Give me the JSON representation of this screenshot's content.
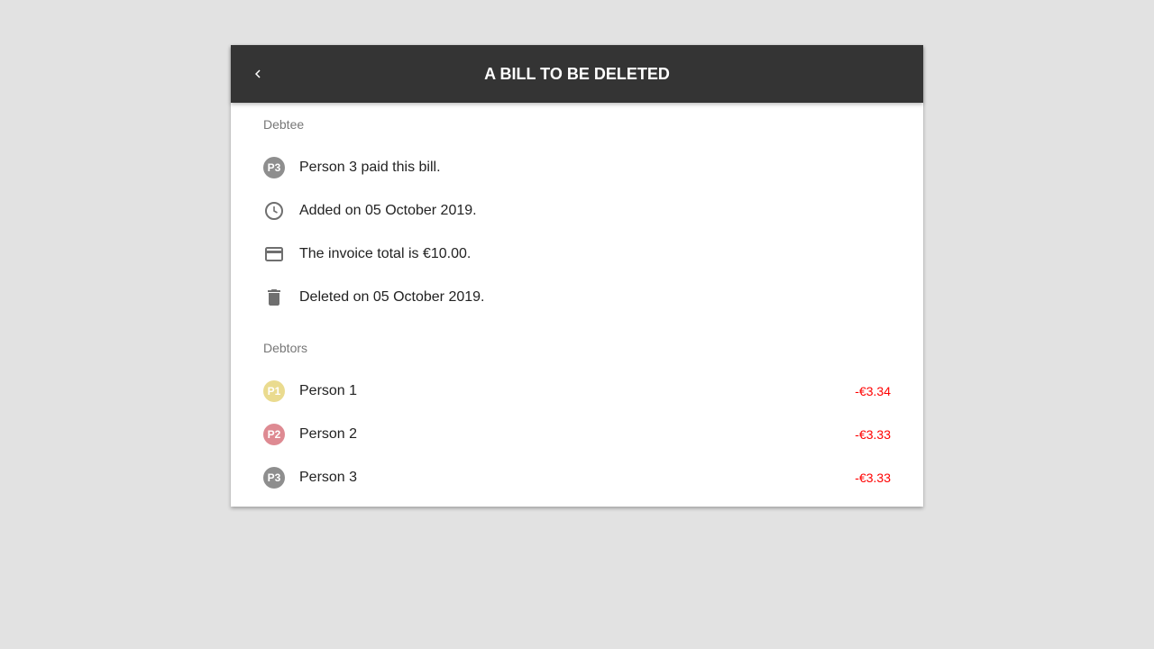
{
  "header": {
    "title": "A BILL TO BE DELETED",
    "back_icon": "chevron-left-icon"
  },
  "debtee": {
    "section_label": "Debtee",
    "items": [
      {
        "icon": "avatar",
        "initials": "P3",
        "color": "#8e8e8e",
        "text": "Person 3 paid this bill."
      },
      {
        "icon": "clock-icon",
        "text": "Added on 05 October 2019."
      },
      {
        "icon": "credit-card-icon",
        "text": "The invoice total is €10.00."
      },
      {
        "icon": "trash-icon",
        "text": "Deleted on 05 October 2019."
      }
    ]
  },
  "debtors": {
    "section_label": "Debtors",
    "amount_color": "#ff0000",
    "items": [
      {
        "initials": "P1",
        "color": "#eadb8f",
        "name": "Person 1",
        "amount": "-€3.34"
      },
      {
        "initials": "P2",
        "color": "#de8a92",
        "name": "Person 2",
        "amount": "-€3.33"
      },
      {
        "initials": "P3",
        "color": "#8e8e8e",
        "name": "Person 3",
        "amount": "-€3.33"
      }
    ]
  }
}
